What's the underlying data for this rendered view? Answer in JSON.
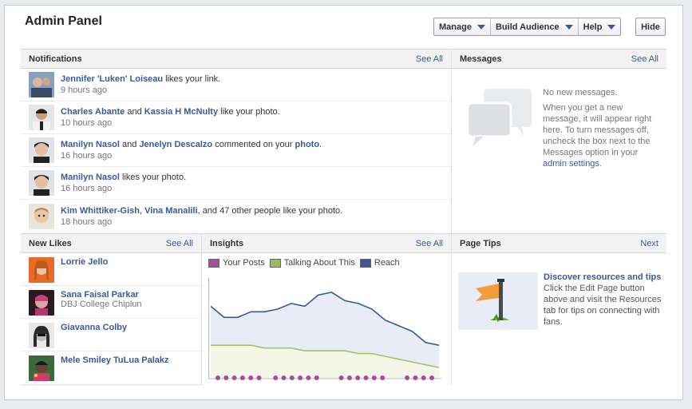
{
  "header": {
    "title": "Admin Panel",
    "menu": [
      {
        "label": "Manage"
      },
      {
        "label": "Build Audience"
      },
      {
        "label": "Help"
      }
    ],
    "hide_label": "Hide"
  },
  "notifications": {
    "title": "Notifications",
    "action": "See All",
    "items": [
      {
        "actor": "Jennifer 'Luken' Loiseau",
        "text": " likes your link.",
        "time": "9 hours ago"
      },
      {
        "actor": "Charles Abante",
        "and": " and ",
        "actor2": "Kassia H McNulty",
        "text": " like your photo.",
        "time": "10 hours ago"
      },
      {
        "actor": "Manilyn Nasol",
        "and": " and ",
        "actor2": "Jenelyn Descalzo",
        "text": " commented on your ",
        "object": "photo",
        "end": ".",
        "time": "16 hours ago"
      },
      {
        "actor": "Manilyn Nasol",
        "text": " likes your photo.",
        "time": "16 hours ago"
      },
      {
        "actor": "Kim Whittiker-Gish",
        "sep": ", ",
        "actor2": "Vina Manalili",
        "text": ", and 47 other people like your photo.",
        "time": "18 hours ago"
      }
    ]
  },
  "messages": {
    "title": "Messages",
    "action": "See All",
    "empty": "No new messages.",
    "help": "When you get a new message, it will appear right here. To turn messages off, uncheck the box next to the Messages option in your ",
    "link": "admin settings",
    "end": "."
  },
  "new_likes": {
    "title": "New Likes",
    "action": "See All",
    "items": [
      {
        "name": "Lorrie Jello",
        "sub": ""
      },
      {
        "name": "Sana Faisal Parkar",
        "sub": "DBJ College Chiplun"
      },
      {
        "name": "Giavanna Colby",
        "sub": ""
      },
      {
        "name": "Mele Smiley TuLua Palakz",
        "sub": ""
      }
    ]
  },
  "insights": {
    "title": "Insights",
    "action": "See All",
    "legend": [
      {
        "label": "Your Posts",
        "color": "#a94ca1"
      },
      {
        "label": "Talking About This",
        "color": "#9dba5b"
      },
      {
        "label": "Reach",
        "color": "#3b5998"
      }
    ]
  },
  "chart_data": {
    "type": "area",
    "series": [
      {
        "name": "Reach",
        "values": [
          26,
          22,
          22,
          24,
          24,
          25,
          27,
          26,
          30,
          31,
          28,
          27,
          25,
          21,
          19,
          17,
          13,
          12
        ]
      },
      {
        "name": "Talking About This",
        "values": [
          12,
          12,
          12,
          12,
          11,
          11,
          11,
          10,
          10,
          10,
          10,
          9,
          9,
          8,
          7,
          6,
          5,
          4
        ]
      },
      {
        "name": "Your Posts",
        "values": [
          1,
          1,
          1,
          1,
          0,
          1,
          1,
          1,
          1,
          0,
          1,
          1,
          1,
          1,
          0,
          1,
          1,
          1
        ]
      }
    ],
    "xlabel": "",
    "ylabel": "",
    "ylim": [
      0,
      35
    ],
    "grid": false,
    "legend": "top-left",
    "colors": {
      "reach_fill": "#e9ecf6",
      "reach_line": "#3b5998",
      "talk_fill": "#f4f7e8",
      "talk_line": "#a6c06a",
      "posts": "#a94ca1"
    }
  },
  "page_tips": {
    "title": "Page Tips",
    "action": "Next",
    "heading": "Discover resources and tips",
    "body": "Click the Edit Page button above and visit the Resources tab for tips on connecting with fans."
  }
}
